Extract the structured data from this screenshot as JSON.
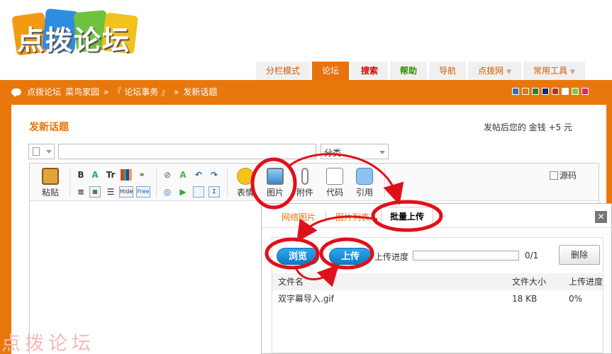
{
  "site": {
    "logo_text": "点拨论坛",
    "watermark": "点拨论坛"
  },
  "nav": [
    {
      "label": "分栏模式",
      "style": "normal"
    },
    {
      "label": "论坛",
      "style": "active"
    },
    {
      "label": "搜索",
      "style": "red"
    },
    {
      "label": "帮助",
      "style": "green"
    },
    {
      "label": "导航",
      "style": "normal"
    },
    {
      "label": "点拨网",
      "style": "normal",
      "dropdown": "▼"
    },
    {
      "label": "常用工具",
      "style": "normal",
      "dropdown": "▼"
    }
  ],
  "breadcrumb": {
    "items": [
      "点拨论坛",
      "菜鸟家园",
      "»",
      "『 论坛事务 』",
      "»",
      "发新话题"
    ]
  },
  "skin_colors": [
    "#2c6ec7",
    "#e8720c",
    "#2e7d32",
    "#1a237e",
    "#c62828",
    "#ffffff",
    "#8bc34a",
    "#e91e63"
  ],
  "page": {
    "title": "发新话题",
    "reward": "发帖后您的 金钱 +5 元"
  },
  "form": {
    "subject_value": "",
    "category": "分类"
  },
  "toolbar": {
    "paste_label": "粘贴",
    "emoticon_label": "表情",
    "image_label": "图片",
    "attach_label": "附件",
    "code_label": "代码",
    "quote_label": "引用",
    "source_label": "源码",
    "bold": "B",
    "font_size": "Tr",
    "hide": "Hide",
    "free": "Free",
    "sigma": "Σ"
  },
  "dialog": {
    "tabs": [
      "网络图片",
      "图片列表",
      "批量上传"
    ],
    "active_tab": 2,
    "close": "✕",
    "browse": "浏览",
    "upload": "上传",
    "progress_label": "上传进度",
    "progress_fraction": 0,
    "progress_count": "0/1",
    "delete": "删除",
    "columns": [
      "文件名",
      "文件大小",
      "上传进度"
    ],
    "files": [
      {
        "name": "双字幕导入.gif",
        "size": "18 KB",
        "progress": "0%"
      }
    ]
  },
  "colors": {
    "brand_orange": "#e8780c",
    "annotation_red": "#e0101a",
    "button_blue": "#1a8fd8"
  }
}
